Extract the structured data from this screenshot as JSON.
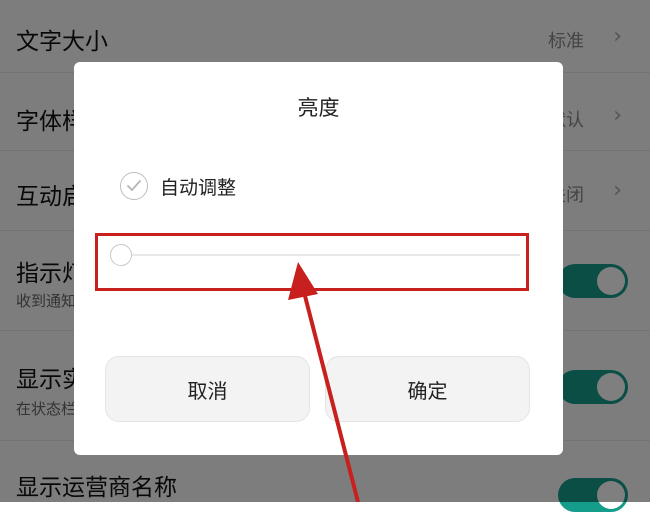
{
  "settings": {
    "rows": [
      {
        "title": "文字大小",
        "value": "标准"
      },
      {
        "title": "字体样式",
        "value": "默认"
      },
      {
        "title": "互动启停",
        "value": "关闭"
      },
      {
        "title": "指示灯",
        "subtitle": "收到通知时闪烁"
      },
      {
        "title": "显示实时网速",
        "subtitle": "在状态栏显示"
      },
      {
        "title": "显示运营商名称"
      }
    ],
    "accent_color": "#159d8c"
  },
  "dialog": {
    "title": "亮度",
    "auto_adjust_label": "自动调整",
    "auto_adjust_checked": true,
    "brightness_level": 0.0,
    "cancel_label": "取消",
    "confirm_label": "确定"
  },
  "annotation": {
    "color": "#c81f1f",
    "target": "brightness-slider"
  }
}
